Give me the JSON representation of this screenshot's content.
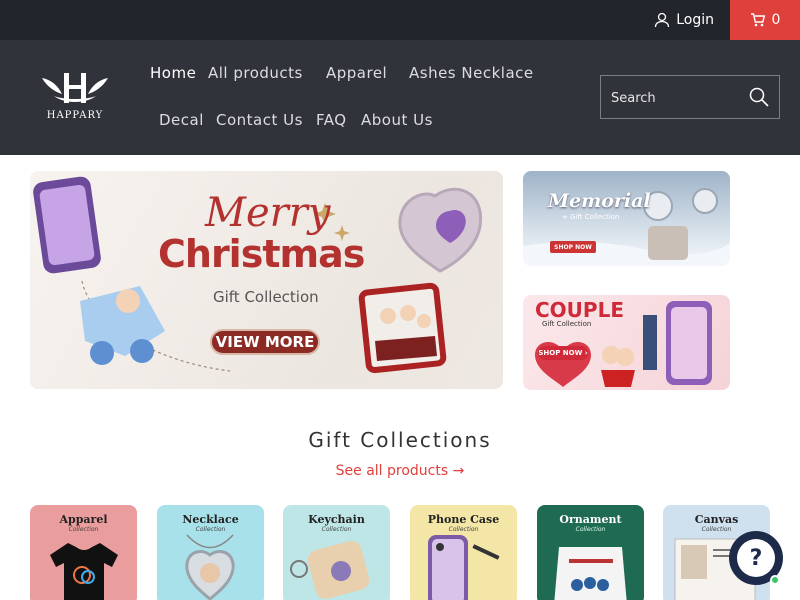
{
  "topbar": {
    "login_label": "Login",
    "cart_count": "0"
  },
  "header": {
    "logo_text": "HAPPARY",
    "nav": {
      "home": "Home",
      "all_products": "All products",
      "apparel": "Apparel",
      "ashes_necklace": "Ashes Necklace",
      "decal": "Decal",
      "contact": "Contact Us",
      "faq": "FAQ",
      "about": "About Us"
    },
    "search_placeholder": "Search"
  },
  "banners": {
    "main": {
      "title_script": "Merry",
      "title_bold": "Christmas",
      "subtitle": "Gift Collection",
      "button": "VIEW MORE"
    },
    "memorial": {
      "title": "Memorial",
      "subtitle": "+ Gift Collection",
      "button": "SHOP NOW"
    },
    "couple": {
      "title": "COUPLE",
      "subtitle": "Gift Collection",
      "button": "SHOP NOW ›"
    }
  },
  "collections": {
    "title": "Gift Collections",
    "see_all": "See all products →",
    "items": [
      {
        "title": "Apparel",
        "sub": "Collection"
      },
      {
        "title": "Necklace",
        "sub": "Collection"
      },
      {
        "title": "Keychain",
        "sub": "Collection"
      },
      {
        "title": "Phone Case",
        "sub": "Collection"
      },
      {
        "title": "Ornament",
        "sub": "Collection"
      },
      {
        "title": "Canvas",
        "sub": "Collection"
      }
    ]
  },
  "chat": {
    "icon_glyph": "?"
  },
  "colors": {
    "topbar": "#22262c",
    "header": "#30343a",
    "accent": "#e0403c"
  }
}
